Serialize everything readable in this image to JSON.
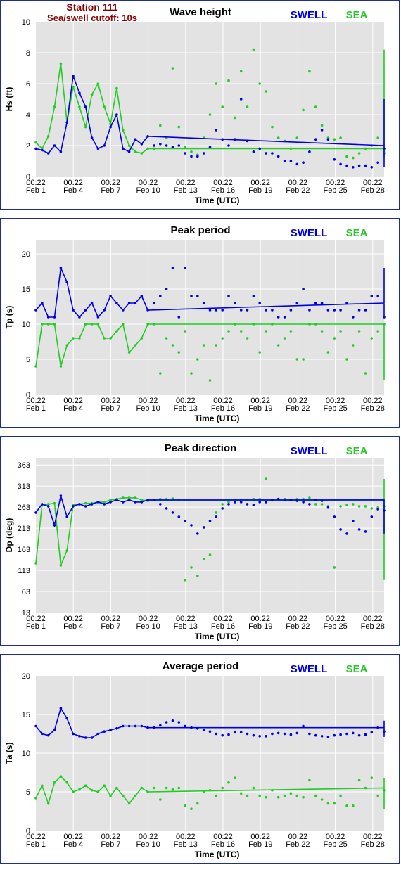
{
  "header": {
    "station": "Station 111",
    "cutoff": "Sea/swell cutoff: 10s"
  },
  "colors": {
    "swell": "#0000e6",
    "sea": "#22cc22"
  },
  "legend": {
    "swell": "SWELL",
    "sea": "SEA"
  },
  "x_axis": {
    "title": "Time (UTC)",
    "tick_time": "00:22",
    "tick_days": [
      "Feb 1",
      "Feb 4",
      "Feb 7",
      "Feb 10",
      "Feb 13",
      "Feb 16",
      "Feb 19",
      "Feb 22",
      "Feb 25",
      "Feb 28"
    ]
  },
  "chart_data": [
    {
      "type": "line",
      "title": "Wave height",
      "ylabel": "Hs (ft)",
      "ylim": [
        0,
        10
      ],
      "yticks": [
        0,
        2,
        4,
        6,
        8,
        10
      ],
      "x": [
        0,
        1,
        2,
        3,
        4,
        5,
        6,
        7,
        8,
        9,
        10,
        11,
        12,
        13,
        14,
        15,
        16,
        17,
        18,
        19,
        20,
        21,
        22,
        23,
        24,
        25,
        26,
        27,
        28,
        29,
        30,
        31,
        32,
        33,
        34,
        35,
        36,
        37,
        38,
        39,
        40,
        41,
        42,
        43,
        44,
        45,
        46,
        47,
        48,
        49,
        50,
        51,
        52,
        53,
        54,
        55,
        56
      ],
      "x_unit": "half-days since Feb 1 00:22",
      "series": [
        {
          "name": "SWELL",
          "values": [
            1.8,
            1.7,
            1.5,
            2.0,
            1.6,
            3.5,
            6.5,
            5.4,
            4.5,
            2.5,
            1.8,
            2.0,
            3.2,
            4.0,
            1.8,
            1.6,
            2.4,
            2.1,
            2.6,
            2.0,
            2.1,
            2.0,
            1.9,
            2.0,
            1.5,
            1.3,
            1.3,
            1.5,
            1.9,
            3.0,
            2.4,
            2.0,
            2.4,
            5.0,
            2.3,
            1.6,
            1.8,
            1.5,
            1.5,
            1.3,
            1.0,
            1.0,
            0.8,
            0.9,
            1.6,
            2.4,
            3.0,
            2.4,
            1.1,
            0.8,
            0.7,
            0.6,
            0.7,
            0.7,
            0.6,
            0.9,
            1.8
          ]
        },
        {
          "name": "SEA",
          "values": [
            2.2,
            1.8,
            2.6,
            4.5,
            7.3,
            3.5,
            5.8,
            4.5,
            3.2,
            5.3,
            6.0,
            4.5,
            3.4,
            5.7,
            3.0,
            2.0,
            1.6,
            1.5,
            1.8,
            1.8,
            3.3,
            2.5,
            7.0,
            3.2,
            1.9,
            1.6,
            1.4,
            2.5,
            4.0,
            6.0,
            4.5,
            6.2,
            3.8,
            6.8,
            4.5,
            8.2,
            6.0,
            5.5,
            3.2,
            2.5,
            2.3,
            1.8,
            2.5,
            4.3,
            6.8,
            4.5,
            3.3,
            2.5,
            2.4,
            2.5,
            1.3,
            1.2,
            1.5,
            1.8,
            2.0,
            2.5,
            1.5
          ]
        }
      ]
    },
    {
      "type": "line",
      "title": "Peak period",
      "ylabel": "Tp (s)",
      "ylim": [
        0,
        22
      ],
      "yticks": [
        0,
        5,
        10,
        15,
        20
      ],
      "x_unit": "half-days since Feb 1 00:22",
      "series": [
        {
          "name": "SWELL",
          "values": [
            12,
            13,
            11,
            11,
            18,
            16,
            12,
            11,
            12,
            13,
            11,
            12,
            14,
            13,
            12,
            13,
            13,
            14,
            12,
            13,
            14,
            15,
            18,
            11,
            18,
            14,
            14,
            13,
            12,
            12,
            12,
            14,
            13,
            12,
            12,
            14,
            13,
            12,
            12,
            11,
            11,
            12,
            13,
            15,
            12,
            13,
            13,
            12,
            12,
            12,
            13,
            11,
            12,
            12,
            14,
            14,
            11
          ]
        },
        {
          "name": "SEA",
          "values": [
            4,
            10,
            10,
            10,
            4,
            7,
            8,
            8,
            10,
            10,
            10,
            8,
            8,
            9,
            10,
            6,
            7,
            8,
            10,
            10,
            3,
            8,
            7,
            6,
            9,
            3,
            5,
            7,
            2,
            7,
            8,
            9,
            10,
            9,
            8,
            10,
            6,
            9,
            10,
            7,
            8,
            9,
            5,
            5,
            10,
            10,
            9,
            6,
            8,
            9,
            5,
            7,
            9,
            3,
            8,
            9,
            10
          ]
        }
      ]
    },
    {
      "type": "line",
      "title": "Peak direction",
      "ylabel": "Dp (deg)",
      "ylim": [
        13,
        380
      ],
      "yticks": [
        13,
        63,
        113,
        163,
        213,
        263,
        313,
        363
      ],
      "x_unit": "half-days since Feb 1 00:22",
      "series": [
        {
          "name": "SWELL",
          "values": [
            250,
            270,
            265,
            220,
            290,
            240,
            265,
            270,
            265,
            270,
            275,
            270,
            275,
            280,
            275,
            280,
            275,
            275,
            280,
            280,
            270,
            260,
            250,
            240,
            230,
            220,
            200,
            215,
            230,
            240,
            260,
            270,
            275,
            275,
            270,
            268,
            275,
            275,
            280,
            282,
            280,
            280,
            278,
            275,
            270,
            280,
            278,
            262,
            240,
            210,
            200,
            230,
            210,
            205,
            240,
            258,
            255
          ]
        },
        {
          "name": "SEA",
          "values": [
            130,
            268,
            270,
            272,
            125,
            160,
            268,
            270,
            272,
            272,
            275,
            275,
            280,
            282,
            285,
            285,
            285,
            280,
            278,
            280,
            282,
            282,
            283,
            280,
            90,
            120,
            100,
            140,
            150,
            250,
            270,
            275,
            280,
            280,
            280,
            282,
            282,
            330,
            280,
            282,
            282,
            280,
            282,
            282,
            285,
            270,
            270,
            265,
            120,
            265,
            268,
            270,
            265,
            265,
            260,
            262,
            265
          ]
        }
      ]
    },
    {
      "type": "line",
      "title": "Average period",
      "ylabel": "Ta (s)",
      "ylim": [
        0,
        20
      ],
      "yticks": [
        0,
        5,
        10,
        15,
        20
      ],
      "x_unit": "half-days since Feb 1 00:22",
      "series": [
        {
          "name": "SWELL",
          "values": [
            13.5,
            12.5,
            12.3,
            13,
            15.8,
            14.5,
            12.5,
            12.2,
            12,
            12,
            12.5,
            12.8,
            13,
            13.2,
            13.5,
            13.5,
            13.5,
            13.5,
            13.3,
            13.3,
            13.6,
            14,
            14.2,
            14,
            13.5,
            13.3,
            13.2,
            13,
            12.8,
            12.5,
            12.3,
            12.4,
            12.7,
            12.7,
            12.5,
            12.3,
            12.2,
            12.2,
            12.5,
            12.6,
            12.5,
            12.4,
            12.6,
            13.5,
            12.5,
            12.3,
            12.2,
            12.1,
            12.3,
            12.4,
            12.5,
            12.6,
            12.3,
            12.4,
            12.7,
            13.3,
            12.8
          ]
        },
        {
          "name": "SEA",
          "values": [
            4.2,
            5.8,
            3.5,
            6.2,
            7,
            6.2,
            5,
            5.3,
            5.8,
            5.2,
            5,
            5.8,
            4.5,
            5.5,
            4.5,
            3.5,
            4.5,
            5.5,
            5,
            5.5,
            4,
            5.5,
            5.3,
            5.5,
            3.2,
            2.8,
            3.5,
            5,
            5.2,
            4.5,
            5.5,
            6.2,
            6.8,
            4.8,
            4.5,
            5.5,
            4.5,
            4.3,
            5.2,
            4.3,
            4.5,
            4.8,
            4.5,
            4.3,
            6.5,
            4.5,
            4,
            3.5,
            3.5,
            4.5,
            3.2,
            3.2,
            6.5,
            5.5,
            6.8,
            4.5,
            5.2
          ]
        }
      ]
    }
  ]
}
